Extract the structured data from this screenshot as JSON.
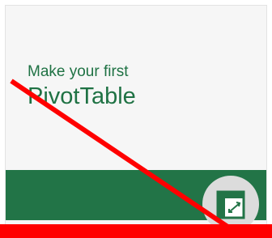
{
  "tile": {
    "line1": "Make your first",
    "line2": "PivotTable",
    "icon": "pivottable-icon"
  },
  "colors": {
    "accent_green": "#227447",
    "text_green": "#1f7244",
    "strike_red": "#ff0000",
    "icon_circle": "#dcdcdc"
  }
}
